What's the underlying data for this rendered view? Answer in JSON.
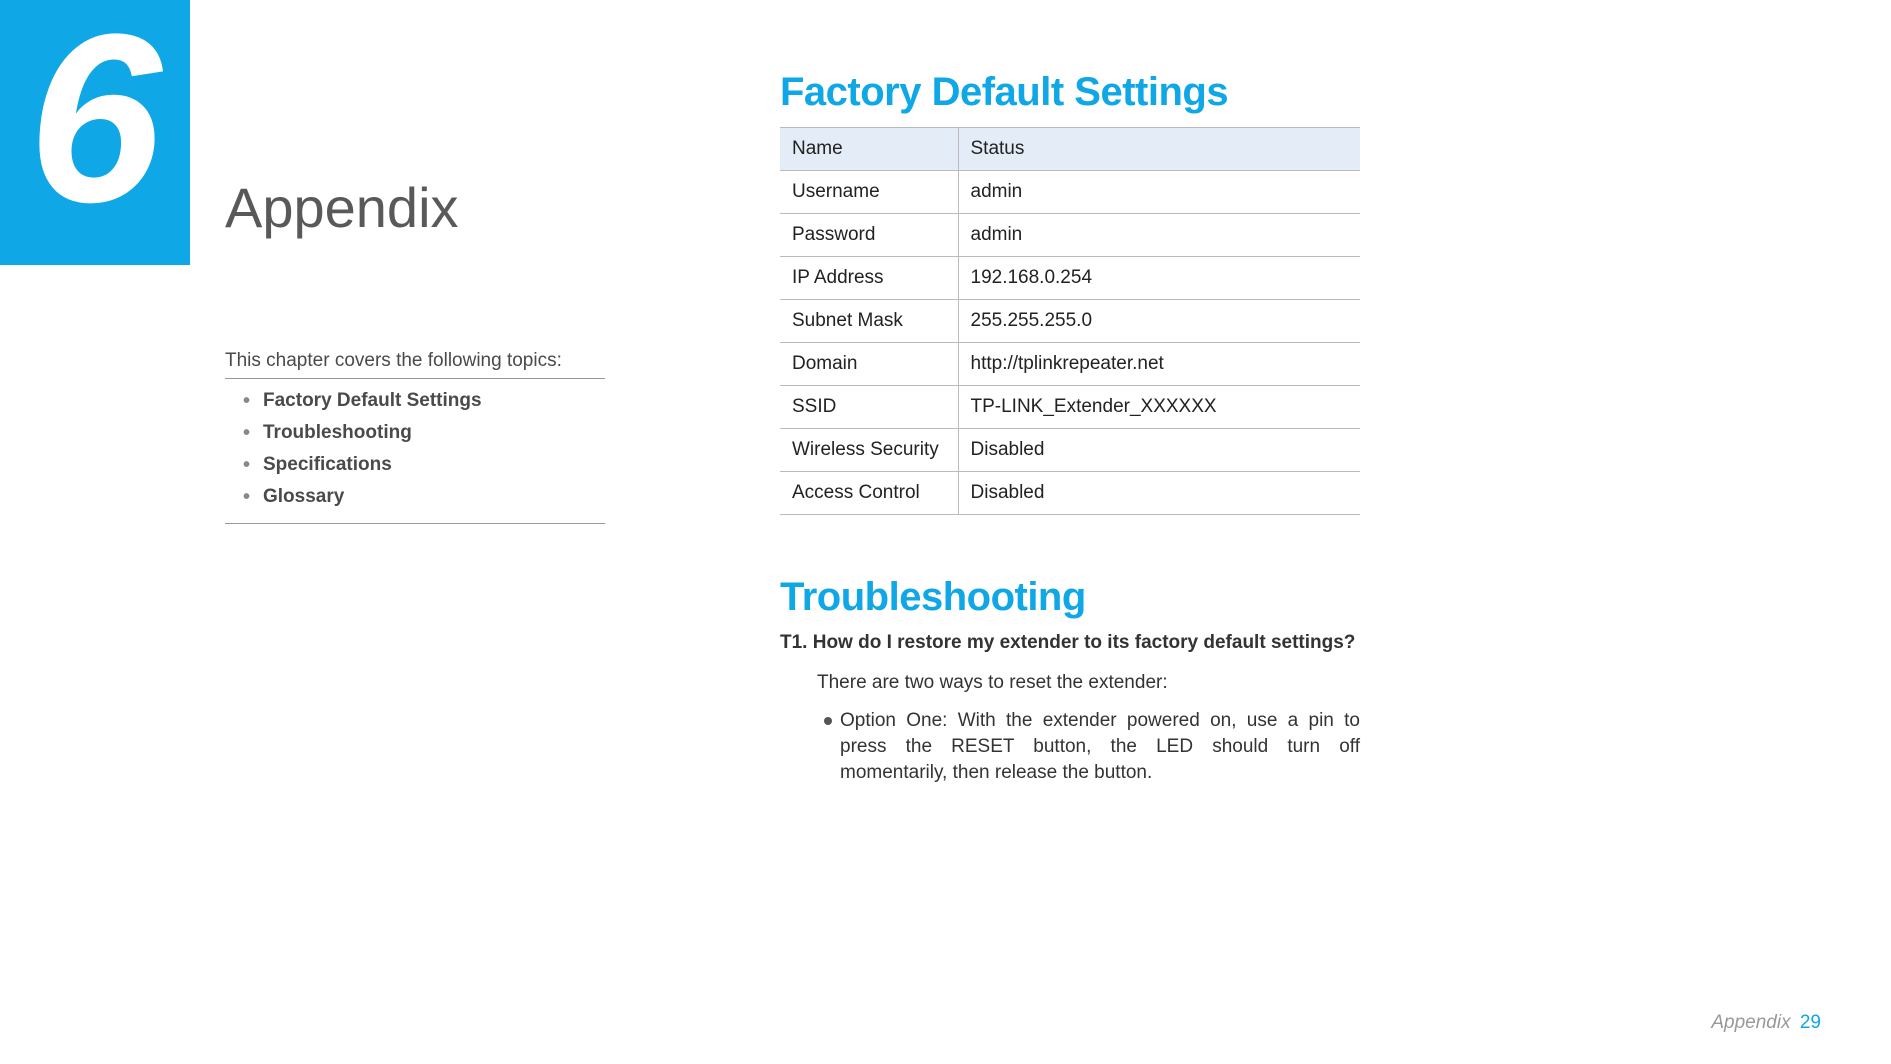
{
  "chapter": {
    "number": "6",
    "title": "Appendix"
  },
  "topics": {
    "intro": "This chapter covers the following topics:",
    "items": [
      "Factory Default Settings",
      "Troubleshooting",
      "Specifications",
      "Glossary"
    ]
  },
  "factory": {
    "heading": "Factory Default Settings",
    "columns": [
      "Name",
      "Status"
    ],
    "rows": [
      {
        "name": "Username",
        "status": "admin"
      },
      {
        "name": "Password",
        "status": "admin"
      },
      {
        "name": "IP Address",
        "status": "192.168.0.254"
      },
      {
        "name": "Subnet Mask",
        "status": "255.255.255.0"
      },
      {
        "name": "Domain",
        "status": "http://tplinkrepeater.net"
      },
      {
        "name": "SSID",
        "status": "TP-LINK_Extender_XXXXXX"
      },
      {
        "name": "Wireless Security",
        "status": "Disabled"
      },
      {
        "name": "Access Control",
        "status": "Disabled"
      }
    ]
  },
  "troubleshooting": {
    "heading": "Troubleshooting",
    "q1_label": "T1.  How do I restore my extender to its factory default settings?",
    "q1_intro": "There are two ways to reset the extender:",
    "q1_option1": "Option One: With the extender powered on, use a pin to press the RESET button, the LED should turn off momentarily, then release the button."
  },
  "footer": {
    "section": "Appendix",
    "page": "29"
  }
}
